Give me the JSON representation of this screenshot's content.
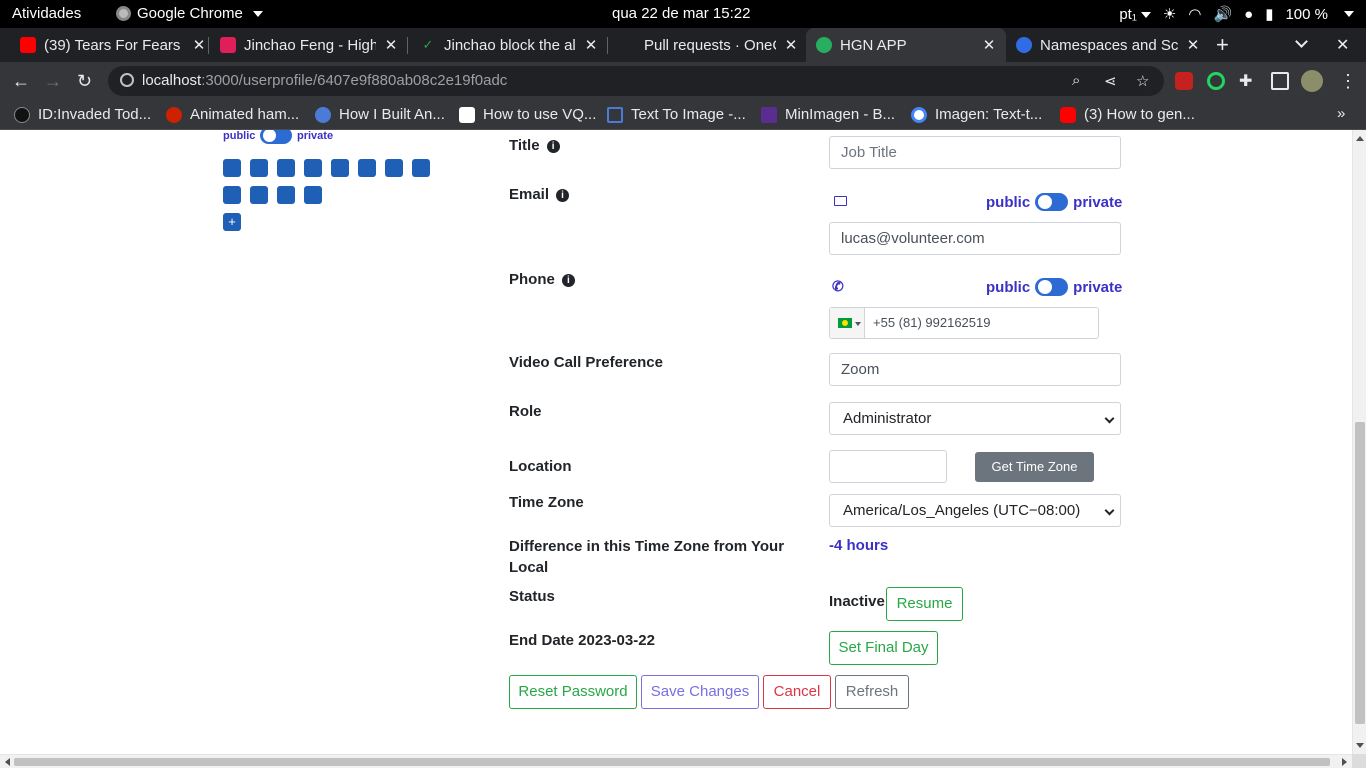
{
  "os_bar": {
    "activities": "Atividades",
    "app_name": "Google Chrome",
    "datetime": "qua 22 de mar  15:22",
    "keyboard": "pt₁",
    "battery": "100 %"
  },
  "tabs": [
    {
      "title": "(39) Tears For Fears",
      "favicon_color": "#ff0000"
    },
    {
      "title": "Jinchao Feng - High",
      "favicon_color": "#e01e5a"
    },
    {
      "title": "Jinchao block the ale",
      "favicon_color": "#2ea043"
    },
    {
      "title": "Pull requests · OneC",
      "favicon_color": "#24292f"
    },
    {
      "title": "HGN APP",
      "favicon_color": "#27ae60"
    },
    {
      "title": "Namespaces and Sc",
      "favicon_color": "#326ce5"
    }
  ],
  "browser": {
    "url_host": "localhost",
    "url_path": ":3000/userprofile/6407e9f880ab08c2e19f0adc"
  },
  "bookmarks": [
    {
      "label": "ID:Invaded Tod...",
      "color": "#111111"
    },
    {
      "label": "Animated ham...",
      "color": "#cc2200"
    },
    {
      "label": "How I Built An...",
      "color": "#4a7bd8"
    },
    {
      "label": "How to use VQ...",
      "color": "#111111"
    },
    {
      "label": "Text To Image -...",
      "color": "#4a7bd8"
    },
    {
      "label": "MinImagen - B...",
      "color": "#5c2d91"
    },
    {
      "label": "Imagen: Text-t...",
      "color": "#4285f4"
    },
    {
      "label": "(3) How to gen...",
      "color": "#ff0000"
    }
  ],
  "left_panel": {
    "public": "public",
    "private": "private",
    "add_label": "+"
  },
  "form": {
    "title_label": "Title",
    "title_placeholder": "Job Title",
    "email_label": "Email",
    "email_value": "lucas@volunteer.com",
    "phone_label": "Phone",
    "phone_value": "+55 (81) 992162519",
    "public": "public",
    "private": "private",
    "video_label": "Video Call Preference",
    "video_value": "Zoom",
    "role_label": "Role",
    "role_value": "Administrator",
    "location_label": "Location",
    "location_value": "",
    "get_tz_button": "Get Time Zone",
    "tz_label": "Time Zone",
    "tz_value": "America/Los_Angeles (UTC−08:00)",
    "diff_label": "Difference in this Time Zone from Your Local",
    "diff_value": "-4 hours",
    "status_label": "Status",
    "status_value": "Inactive",
    "resume_button": "Resume",
    "end_date_label": "End Date 2023-03-22",
    "final_day_button": "Set Final Day"
  },
  "actions": {
    "reset": "Reset Password",
    "save": "Save Changes",
    "cancel": "Cancel",
    "refresh": "Refresh"
  }
}
